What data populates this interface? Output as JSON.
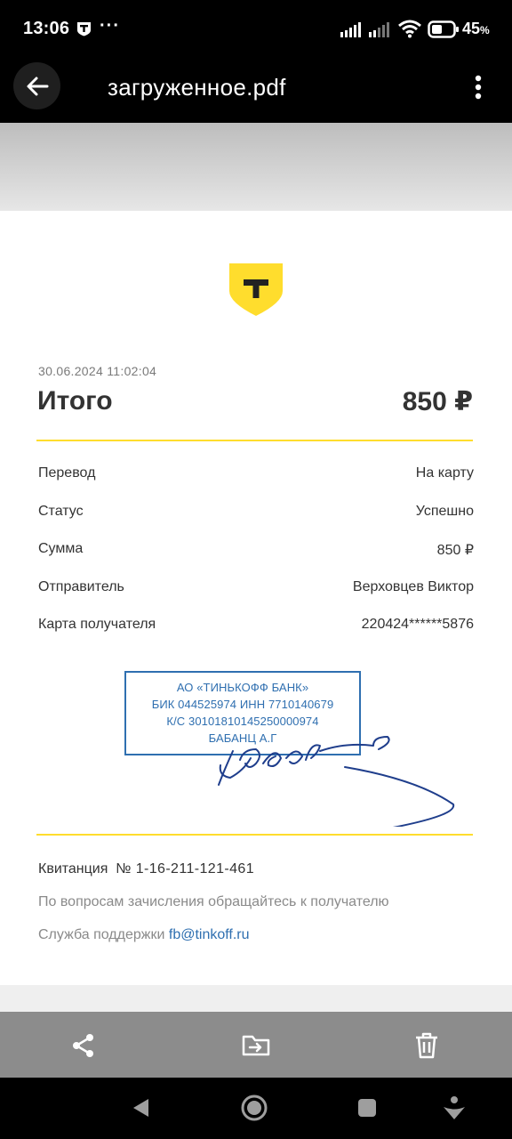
{
  "status_bar": {
    "time": "13:06",
    "overflow": "···",
    "battery_percent": "45",
    "percent_sign": "%",
    "icons": [
      "tinkoff-app-icon",
      "signal-icon",
      "signal-icon",
      "wifi-icon",
      "battery-icon"
    ]
  },
  "toolbar": {
    "title": "загруженное.pdf",
    "icons": [
      "back-arrow-icon",
      "more-vertical-icon"
    ]
  },
  "receipt": {
    "logo_letter": "T",
    "date": "30.06.2024 11:02:04",
    "total_label": "Итого",
    "total_value": "850 ₽",
    "rows": [
      {
        "label": "Перевод",
        "value": "На карту"
      },
      {
        "label": "Статус",
        "value": "Успешно"
      },
      {
        "label": "Сумма",
        "value": "850 ₽"
      },
      {
        "label": "Отправитель",
        "value": "Верховцев Виктор"
      },
      {
        "label": "Карта получателя",
        "value": "220424******5876"
      }
    ],
    "stamp": {
      "line1": "АО «ТИНЬКОФФ БАНК»",
      "line2": "БИК 044525974 ИНН 7710140679",
      "line3": "К/С 30101810145250000974",
      "line4": "БАБАНЦ А.Г"
    },
    "receipt_label": "Квитанция",
    "receipt_number": "№ 1-16-211-121-461",
    "note": "По вопросам зачисления обращайтесь к получателю",
    "support_label": "Служба поддержки",
    "support_email": "fb@tinkoff.ru",
    "accent_color": "#ffdd2d",
    "link_color": "#2f6fb0"
  },
  "action_bar": {
    "icons": [
      "share-icon",
      "move-to-folder-icon",
      "delete-icon"
    ]
  },
  "nav_bar": {
    "icons": [
      "nav-back-icon",
      "nav-home-icon",
      "nav-recents-icon",
      "nav-assistant-icon"
    ]
  }
}
